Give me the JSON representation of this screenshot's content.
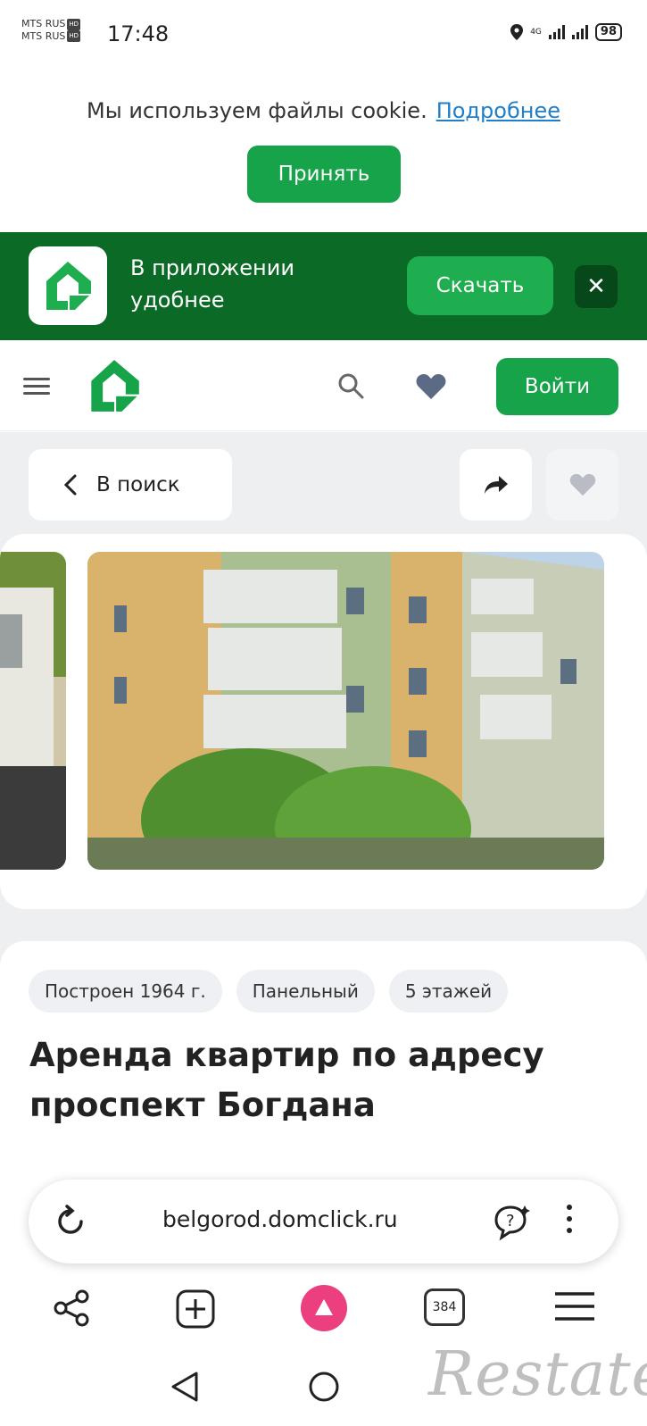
{
  "status_bar": {
    "carrier_1": "MTS RUS",
    "carrier_2": "MTS RUS",
    "hd_badge": "HD",
    "time": "17:48",
    "network": "4G",
    "battery": "98"
  },
  "cookie_banner": {
    "text": "Мы используем файлы cookie.",
    "link": "Подробнее",
    "accept_label": "Принять"
  },
  "app_banner": {
    "text": "В приложении удобнее",
    "download_label": "Скачать",
    "close_label": "✕"
  },
  "header": {
    "login_label": "Войти"
  },
  "nav": {
    "back_label": "В поиск"
  },
  "listing": {
    "tags": [
      "Построен 1964 г.",
      "Панельный",
      "5 этажей"
    ],
    "title": "Аренда квартир по адресу проспект Богдана"
  },
  "browser": {
    "url": "belgorod.domclick.ru",
    "tabs_count": "384"
  },
  "watermark": "Restate",
  "colors": {
    "brand_green": "#16a34a",
    "banner_green": "#0b6a26",
    "link_blue": "#1f7fc8",
    "alice_pink": "#ec3f7f"
  }
}
